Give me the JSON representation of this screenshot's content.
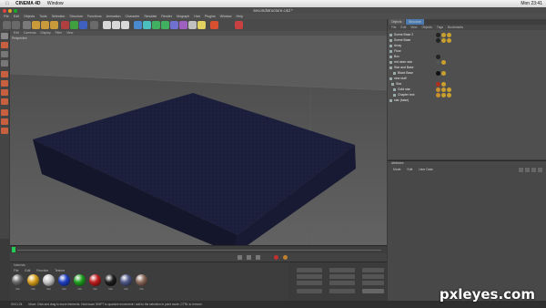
{
  "mac_menubar": {
    "app": "CINEMA 4D",
    "window_menu": "Window",
    "clock": "Mon 23:41"
  },
  "window": {
    "title": "secondstructure.c4d *"
  },
  "app_menu": [
    "File",
    "Edit",
    "Objects",
    "Tools",
    "Selection",
    "Structure",
    "Functions",
    "Animation",
    "Character",
    "Simulate",
    "Render",
    "Mograph",
    "Hair",
    "Plugins",
    "Window",
    "Help"
  ],
  "viewport": {
    "menu": [
      "Edit",
      "Cameras",
      "Display",
      "Filter",
      "View"
    ],
    "label": "Perspective"
  },
  "object_manager": {
    "tabs": [
      "Objects",
      "Structure"
    ],
    "menu": [
      "File",
      "Edit",
      "View",
      "Objects",
      "Tags",
      "Bookmarks"
    ],
    "objects": [
      {
        "label": "Scene Base 2"
      },
      {
        "label": "Scene Base"
      },
      {
        "label": "Array"
      },
      {
        "label": "Floor"
      },
      {
        "label": "Box"
      },
      {
        "label": "red atom star"
      },
      {
        "label": "Star and Base"
      },
      {
        "label": "Black Base"
      },
      {
        "label": "new stuff"
      },
      {
        "label": "Star"
      },
      {
        "label": "Gold star"
      },
      {
        "label": "Chapter text"
      },
      {
        "label": "star (base)"
      }
    ]
  },
  "attributes": {
    "title": "Attributes",
    "menu": [
      "Mode",
      "Edit",
      "User Data"
    ]
  },
  "material_editor": {
    "title": "Materials",
    "menu": [
      "File",
      "Edit",
      "Function",
      "Texture"
    ],
    "materials": [
      {
        "label": "Mat",
        "color": "#6a6a6a"
      },
      {
        "label": "Mat",
        "color": "#d8a020"
      },
      {
        "label": "Mat",
        "color": "#c8c8c8"
      },
      {
        "label": "Mat",
        "color": "#2040c0"
      },
      {
        "label": "Mat",
        "color": "#20a020"
      },
      {
        "label": "Mat",
        "color": "#c02020"
      },
      {
        "label": "Mat",
        "color": "#202020"
      },
      {
        "label": "Mat",
        "color": "#505a8a"
      },
      {
        "label": "Mat",
        "color": "#8a6a5a"
      }
    ]
  },
  "status_bar": {
    "time": "00:01:24",
    "message": "Move: Click and drag to move elements. Hold down SHIFT to quantize movement / add to the selection in point mode, CTRL to remove."
  },
  "watermark": "pxleyes.com",
  "colors": {
    "accent": "#4a7ab0",
    "box_top": "#1a1d3a",
    "timeline_marker": "#22cc55"
  }
}
